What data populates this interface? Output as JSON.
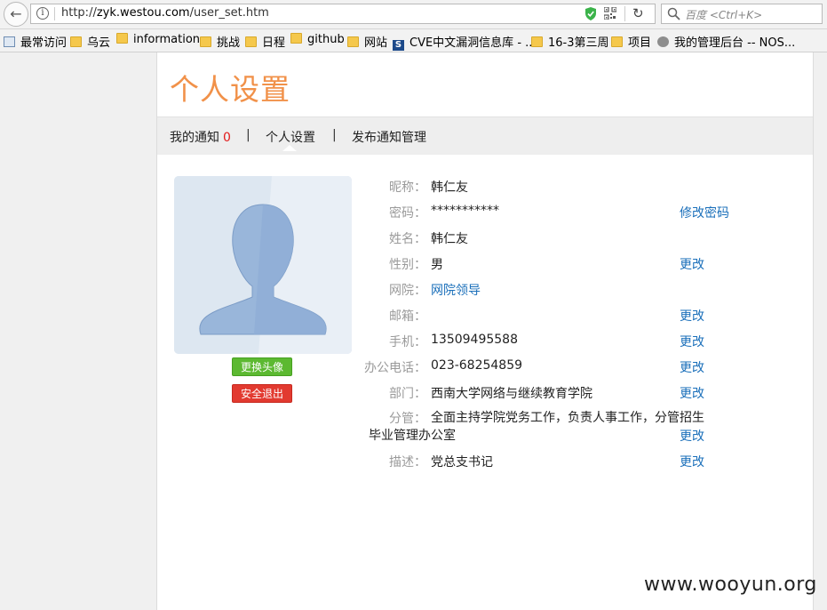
{
  "browser": {
    "url_prefix": "http://",
    "url_host": "zyk.westou.com",
    "url_path": "/user_set.htm",
    "search_placeholder": "百度 <Ctrl+K>",
    "bookmarks": [
      {
        "label": "最常访问",
        "icon": "page-icon"
      },
      {
        "label": "乌云",
        "icon": "folder-icon"
      },
      {
        "label": "information",
        "icon": "folder-icon"
      },
      {
        "label": "挑战",
        "icon": "folder-icon"
      },
      {
        "label": "日程",
        "icon": "folder-icon"
      },
      {
        "label": "github",
        "icon": "folder-icon"
      },
      {
        "label": "网站",
        "icon": "folder-icon"
      },
      {
        "label": "CVE中文漏洞信息库 - ...",
        "icon": "s-icon"
      },
      {
        "label": "16-3第三周",
        "icon": "folder-icon"
      },
      {
        "label": "项目",
        "icon": "folder-icon"
      },
      {
        "label": "我的管理后台 -- NOS...",
        "icon": "globe-icon"
      }
    ]
  },
  "page": {
    "title": "个人设置",
    "tabs": [
      {
        "label": "我的通知",
        "count": "0"
      },
      {
        "label": "个人设置"
      },
      {
        "label": "发布通知管理"
      }
    ],
    "tab_separator": "|",
    "buttons": {
      "change_avatar": "更换头像",
      "logout": "安全退出"
    },
    "profile": [
      {
        "label": "昵称：",
        "value": "韩仁友",
        "action": ""
      },
      {
        "label": "密码：",
        "value": "***********",
        "action": "修改密码"
      },
      {
        "label": "姓名：",
        "value": "韩仁友",
        "action": ""
      },
      {
        "label": "性别：",
        "value": "男",
        "action": "更改"
      },
      {
        "label": "网院：",
        "value": "网院领导",
        "action": ""
      },
      {
        "label": "邮箱：",
        "value": "",
        "action": "更改"
      },
      {
        "label": "手机：",
        "value": "13509495588",
        "action": "更改"
      },
      {
        "label": "办公电话：",
        "value": "023-68254859",
        "action": "更改"
      },
      {
        "label": "部门：",
        "value": "西南大学网络与继续教育学院",
        "action": "更改"
      },
      {
        "label": "分管：",
        "value": "全面主持学院党务工作，负责人事工作，分管招生毕业管理办公室",
        "action": "更改"
      },
      {
        "label": "描述：",
        "value": "党总支书记",
        "action": "更改"
      }
    ]
  },
  "watermark": "www.wooyun.org",
  "colors": {
    "title": "#f19149",
    "link": "#1a6fba",
    "count": "#e21b1b",
    "green_button": "#5cb931",
    "red_button": "#e23a30"
  }
}
